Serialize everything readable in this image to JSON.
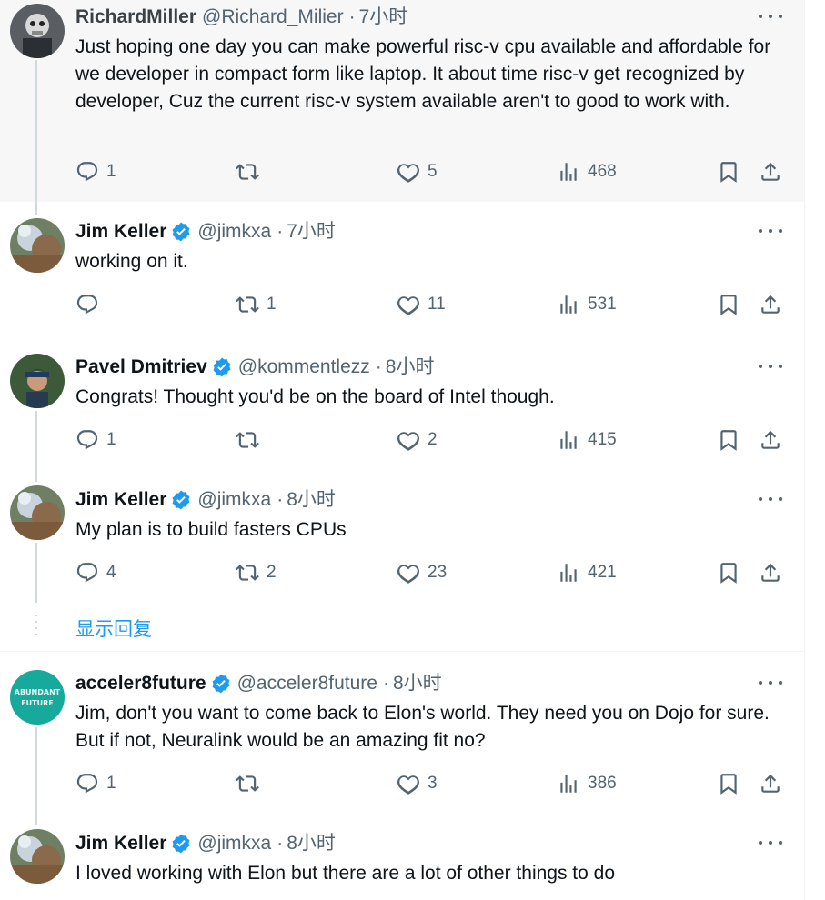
{
  "tweets": [
    {
      "name": "RichardMiller",
      "handle": "@Richard_Milier",
      "time": "7小时",
      "verified": false,
      "text": "Just hoping one day you can make powerful risc-v cpu available and affordable for we developer in compact form like laptop. It about time risc-v get recognized by developer, Cuz the current risc-v system available aren't to good to work with.",
      "replies": "1",
      "retweets": "",
      "likes": "5",
      "views": "468"
    },
    {
      "name": "Jim Keller",
      "handle": "@jimkxa",
      "time": "7小时",
      "verified": true,
      "text": "working on it.",
      "replies": "",
      "retweets": "1",
      "likes": "11",
      "views": "531"
    },
    {
      "name": "Pavel Dmitriev",
      "handle": "@kommentlezz",
      "time": "8小时",
      "verified": true,
      "text": "Congrats! Thought you'd be on the board of Intel though.",
      "replies": "1",
      "retweets": "",
      "likes": "2",
      "views": "415"
    },
    {
      "name": "Jim Keller",
      "handle": "@jimkxa",
      "time": "8小时",
      "verified": true,
      "text": "My plan is to build fasters CPUs",
      "replies": "4",
      "retweets": "2",
      "likes": "23",
      "views": "421"
    },
    {
      "name": "acceler8future",
      "handle": "@acceler8future",
      "time": "8小时",
      "verified": true,
      "avatar_text": [
        "ABUNDANT",
        "FUTURE"
      ],
      "text": "Jim, don't you want to come back to Elon's world.  They need you on Dojo for sure.  But if not, Neuralink would be an amazing fit no?",
      "replies": "1",
      "retweets": "",
      "likes": "3",
      "views": "386"
    },
    {
      "name": "Jim Keller",
      "handle": "@jimkxa",
      "time": "8小时",
      "verified": true,
      "text": "I loved working with Elon but there are a lot of other things to do"
    }
  ],
  "show_replies": "显示回复",
  "separator": "·",
  "colors": {
    "accent": "#1d9bf0",
    "muted": "#536471",
    "text": "#0f1419",
    "avatar_teal": "#17a99b"
  }
}
